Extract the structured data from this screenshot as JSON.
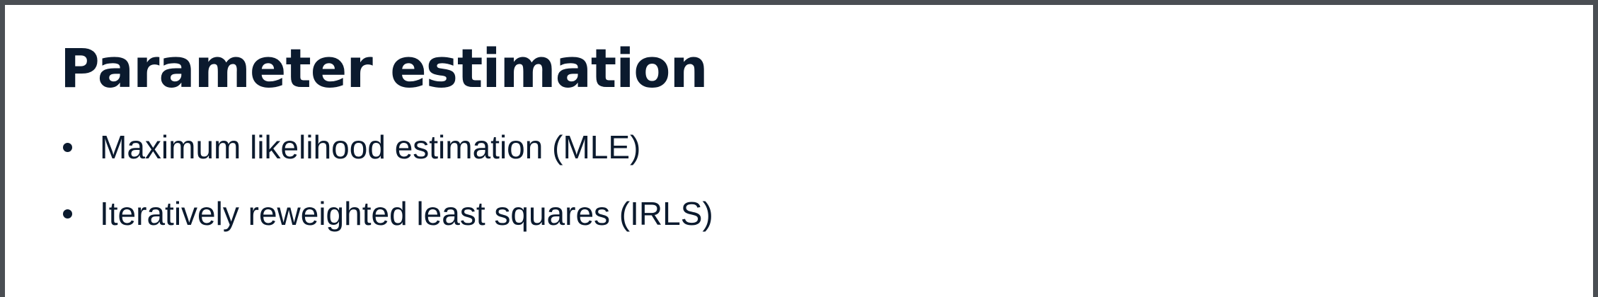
{
  "slide": {
    "title": "Parameter estimation",
    "bullets": [
      "Maximum likelihood estimation (MLE)",
      "Iteratively reweighted least squares (IRLS)"
    ]
  }
}
